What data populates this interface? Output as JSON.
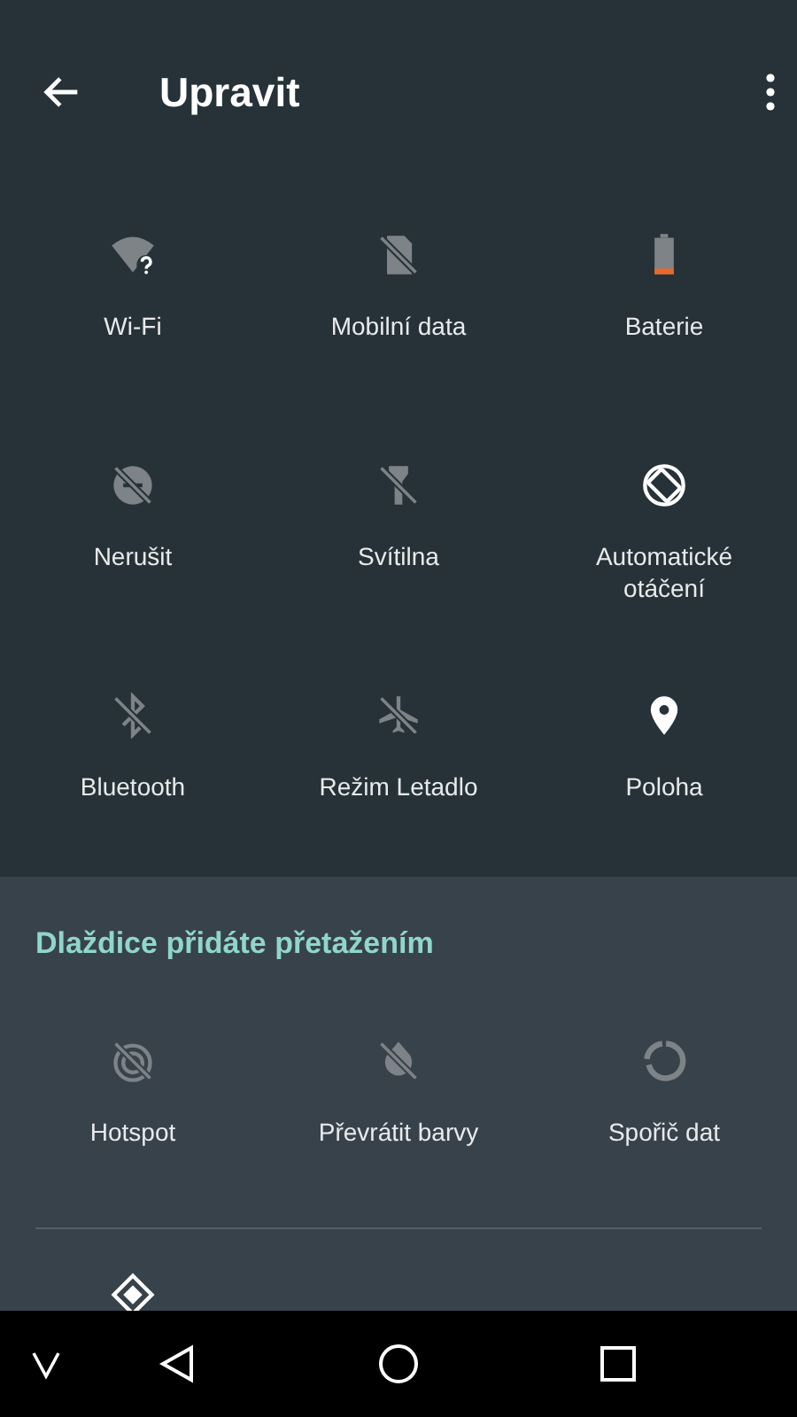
{
  "header": {
    "title": "Upravit"
  },
  "active_tiles": [
    {
      "kind": "wifi",
      "label": "Wi-Fi",
      "on": false
    },
    {
      "kind": "mobile",
      "label": "Mobilní data",
      "on": false
    },
    {
      "kind": "battery",
      "label": "Baterie",
      "on": false
    },
    {
      "kind": "dnd",
      "label": "Nerušit",
      "on": false
    },
    {
      "kind": "flashlight",
      "label": "Svítilna",
      "on": false
    },
    {
      "kind": "rotate",
      "label": "Automatické otáčení",
      "on": true
    },
    {
      "kind": "bluetooth",
      "label": "Bluetooth",
      "on": false
    },
    {
      "kind": "airplane",
      "label": "Režim Letadlo",
      "on": false
    },
    {
      "kind": "location",
      "label": "Poloha",
      "on": true
    }
  ],
  "available": {
    "heading": "Dlaždice přidáte přetažením",
    "tiles": [
      {
        "kind": "hotspot",
        "label": "Hotspot",
        "on": false
      },
      {
        "kind": "invert",
        "label": "Převrátit barvy",
        "on": false
      },
      {
        "kind": "datasaver",
        "label": "Spořič dat",
        "on": false
      }
    ],
    "partial_tile": {
      "kind": "diamond",
      "on": true
    }
  }
}
